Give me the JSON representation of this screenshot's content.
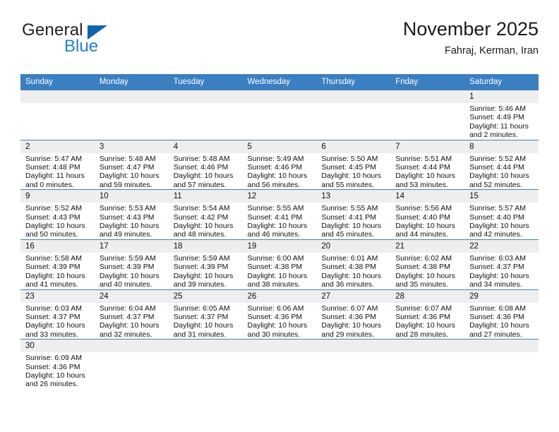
{
  "brand": {
    "name_top": "General",
    "name_bottom": "Blue",
    "triangle_color": "#1065a8",
    "blue_color": "#2083c8"
  },
  "header": {
    "title": "November 2025",
    "subtitle": "Fahraj, Kerman, Iran"
  },
  "theme": {
    "header_row_bg": "#3a7fc1",
    "header_row_text": "#ffffff",
    "daynum_bg": "#eeeeee",
    "grid_line": "#4a7fb5"
  },
  "weekday_headers": [
    "Sunday",
    "Monday",
    "Tuesday",
    "Wednesday",
    "Thursday",
    "Friday",
    "Saturday"
  ],
  "weeks": [
    [
      {
        "day": "",
        "sunrise": "",
        "sunset": "",
        "daylight_line1": "",
        "daylight_line2": ""
      },
      {
        "day": "",
        "sunrise": "",
        "sunset": "",
        "daylight_line1": "",
        "daylight_line2": ""
      },
      {
        "day": "",
        "sunrise": "",
        "sunset": "",
        "daylight_line1": "",
        "daylight_line2": ""
      },
      {
        "day": "",
        "sunrise": "",
        "sunset": "",
        "daylight_line1": "",
        "daylight_line2": ""
      },
      {
        "day": "",
        "sunrise": "",
        "sunset": "",
        "daylight_line1": "",
        "daylight_line2": ""
      },
      {
        "day": "",
        "sunrise": "",
        "sunset": "",
        "daylight_line1": "",
        "daylight_line2": ""
      },
      {
        "day": "1",
        "sunrise": "Sunrise: 5:46 AM",
        "sunset": "Sunset: 4:49 PM",
        "daylight_line1": "Daylight: 11 hours",
        "daylight_line2": "and 2 minutes."
      }
    ],
    [
      {
        "day": "2",
        "sunrise": "Sunrise: 5:47 AM",
        "sunset": "Sunset: 4:48 PM",
        "daylight_line1": "Daylight: 11 hours",
        "daylight_line2": "and 0 minutes."
      },
      {
        "day": "3",
        "sunrise": "Sunrise: 5:48 AM",
        "sunset": "Sunset: 4:47 PM",
        "daylight_line1": "Daylight: 10 hours",
        "daylight_line2": "and 59 minutes."
      },
      {
        "day": "4",
        "sunrise": "Sunrise: 5:48 AM",
        "sunset": "Sunset: 4:46 PM",
        "daylight_line1": "Daylight: 10 hours",
        "daylight_line2": "and 57 minutes."
      },
      {
        "day": "5",
        "sunrise": "Sunrise: 5:49 AM",
        "sunset": "Sunset: 4:46 PM",
        "daylight_line1": "Daylight: 10 hours",
        "daylight_line2": "and 56 minutes."
      },
      {
        "day": "6",
        "sunrise": "Sunrise: 5:50 AM",
        "sunset": "Sunset: 4:45 PM",
        "daylight_line1": "Daylight: 10 hours",
        "daylight_line2": "and 55 minutes."
      },
      {
        "day": "7",
        "sunrise": "Sunrise: 5:51 AM",
        "sunset": "Sunset: 4:44 PM",
        "daylight_line1": "Daylight: 10 hours",
        "daylight_line2": "and 53 minutes."
      },
      {
        "day": "8",
        "sunrise": "Sunrise: 5:52 AM",
        "sunset": "Sunset: 4:44 PM",
        "daylight_line1": "Daylight: 10 hours",
        "daylight_line2": "and 52 minutes."
      }
    ],
    [
      {
        "day": "9",
        "sunrise": "Sunrise: 5:52 AM",
        "sunset": "Sunset: 4:43 PM",
        "daylight_line1": "Daylight: 10 hours",
        "daylight_line2": "and 50 minutes."
      },
      {
        "day": "10",
        "sunrise": "Sunrise: 5:53 AM",
        "sunset": "Sunset: 4:43 PM",
        "daylight_line1": "Daylight: 10 hours",
        "daylight_line2": "and 49 minutes."
      },
      {
        "day": "11",
        "sunrise": "Sunrise: 5:54 AM",
        "sunset": "Sunset: 4:42 PM",
        "daylight_line1": "Daylight: 10 hours",
        "daylight_line2": "and 48 minutes."
      },
      {
        "day": "12",
        "sunrise": "Sunrise: 5:55 AM",
        "sunset": "Sunset: 4:41 PM",
        "daylight_line1": "Daylight: 10 hours",
        "daylight_line2": "and 46 minutes."
      },
      {
        "day": "13",
        "sunrise": "Sunrise: 5:55 AM",
        "sunset": "Sunset: 4:41 PM",
        "daylight_line1": "Daylight: 10 hours",
        "daylight_line2": "and 45 minutes."
      },
      {
        "day": "14",
        "sunrise": "Sunrise: 5:56 AM",
        "sunset": "Sunset: 4:40 PM",
        "daylight_line1": "Daylight: 10 hours",
        "daylight_line2": "and 44 minutes."
      },
      {
        "day": "15",
        "sunrise": "Sunrise: 5:57 AM",
        "sunset": "Sunset: 4:40 PM",
        "daylight_line1": "Daylight: 10 hours",
        "daylight_line2": "and 42 minutes."
      }
    ],
    [
      {
        "day": "16",
        "sunrise": "Sunrise: 5:58 AM",
        "sunset": "Sunset: 4:39 PM",
        "daylight_line1": "Daylight: 10 hours",
        "daylight_line2": "and 41 minutes."
      },
      {
        "day": "17",
        "sunrise": "Sunrise: 5:59 AM",
        "sunset": "Sunset: 4:39 PM",
        "daylight_line1": "Daylight: 10 hours",
        "daylight_line2": "and 40 minutes."
      },
      {
        "day": "18",
        "sunrise": "Sunrise: 5:59 AM",
        "sunset": "Sunset: 4:39 PM",
        "daylight_line1": "Daylight: 10 hours",
        "daylight_line2": "and 39 minutes."
      },
      {
        "day": "19",
        "sunrise": "Sunrise: 6:00 AM",
        "sunset": "Sunset: 4:38 PM",
        "daylight_line1": "Daylight: 10 hours",
        "daylight_line2": "and 38 minutes."
      },
      {
        "day": "20",
        "sunrise": "Sunrise: 6:01 AM",
        "sunset": "Sunset: 4:38 PM",
        "daylight_line1": "Daylight: 10 hours",
        "daylight_line2": "and 36 minutes."
      },
      {
        "day": "21",
        "sunrise": "Sunrise: 6:02 AM",
        "sunset": "Sunset: 4:38 PM",
        "daylight_line1": "Daylight: 10 hours",
        "daylight_line2": "and 35 minutes."
      },
      {
        "day": "22",
        "sunrise": "Sunrise: 6:03 AM",
        "sunset": "Sunset: 4:37 PM",
        "daylight_line1": "Daylight: 10 hours",
        "daylight_line2": "and 34 minutes."
      }
    ],
    [
      {
        "day": "23",
        "sunrise": "Sunrise: 6:03 AM",
        "sunset": "Sunset: 4:37 PM",
        "daylight_line1": "Daylight: 10 hours",
        "daylight_line2": "and 33 minutes."
      },
      {
        "day": "24",
        "sunrise": "Sunrise: 6:04 AM",
        "sunset": "Sunset: 4:37 PM",
        "daylight_line1": "Daylight: 10 hours",
        "daylight_line2": "and 32 minutes."
      },
      {
        "day": "25",
        "sunrise": "Sunrise: 6:05 AM",
        "sunset": "Sunset: 4:37 PM",
        "daylight_line1": "Daylight: 10 hours",
        "daylight_line2": "and 31 minutes."
      },
      {
        "day": "26",
        "sunrise": "Sunrise: 6:06 AM",
        "sunset": "Sunset: 4:36 PM",
        "daylight_line1": "Daylight: 10 hours",
        "daylight_line2": "and 30 minutes."
      },
      {
        "day": "27",
        "sunrise": "Sunrise: 6:07 AM",
        "sunset": "Sunset: 4:36 PM",
        "daylight_line1": "Daylight: 10 hours",
        "daylight_line2": "and 29 minutes."
      },
      {
        "day": "28",
        "sunrise": "Sunrise: 6:07 AM",
        "sunset": "Sunset: 4:36 PM",
        "daylight_line1": "Daylight: 10 hours",
        "daylight_line2": "and 28 minutes."
      },
      {
        "day": "29",
        "sunrise": "Sunrise: 6:08 AM",
        "sunset": "Sunset: 4:36 PM",
        "daylight_line1": "Daylight: 10 hours",
        "daylight_line2": "and 27 minutes."
      }
    ],
    [
      {
        "day": "30",
        "sunrise": "Sunrise: 6:09 AM",
        "sunset": "Sunset: 4:36 PM",
        "daylight_line1": "Daylight: 10 hours",
        "daylight_line2": "and 26 minutes."
      },
      {
        "day": "",
        "sunrise": "",
        "sunset": "",
        "daylight_line1": "",
        "daylight_line2": ""
      },
      {
        "day": "",
        "sunrise": "",
        "sunset": "",
        "daylight_line1": "",
        "daylight_line2": ""
      },
      {
        "day": "",
        "sunrise": "",
        "sunset": "",
        "daylight_line1": "",
        "daylight_line2": ""
      },
      {
        "day": "",
        "sunrise": "",
        "sunset": "",
        "daylight_line1": "",
        "daylight_line2": ""
      },
      {
        "day": "",
        "sunrise": "",
        "sunset": "",
        "daylight_line1": "",
        "daylight_line2": ""
      },
      {
        "day": "",
        "sunrise": "",
        "sunset": "",
        "daylight_line1": "",
        "daylight_line2": ""
      }
    ]
  ]
}
